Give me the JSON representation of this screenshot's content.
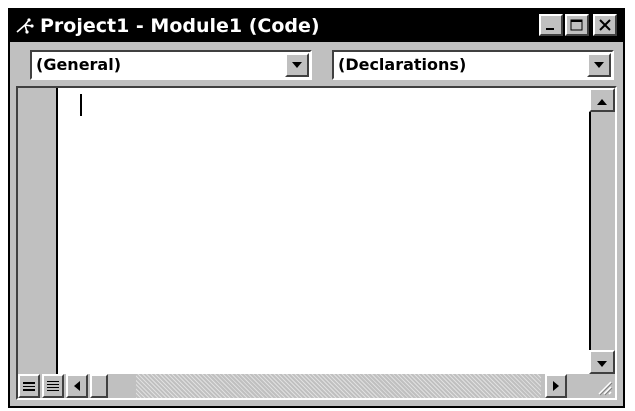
{
  "window": {
    "title": "Project1 - Module1 (Code)",
    "icons": {
      "app": "project-code-icon",
      "minimize": "minimize-icon",
      "maximize": "maximize-icon",
      "close": "close-icon"
    }
  },
  "object_combo": {
    "selected": "(General)",
    "icon": "chevron-down-icon"
  },
  "procedure_combo": {
    "selected": "(Declarations)",
    "icon": "chevron-down-icon"
  },
  "editor": {
    "code_text": ""
  },
  "scrollbars": {
    "vertical_icons": [
      "scroll-up-icon",
      "scroll-down-icon"
    ],
    "horizontal_icons": [
      "scroll-left-icon",
      "scroll-right-icon"
    ]
  },
  "view_buttons": {
    "procedure_view_icon": "procedure-view-icon",
    "full_module_view_icon": "full-module-view-icon"
  },
  "colors": {
    "titlebar": "#000000",
    "chrome": "#c0c0c0",
    "editor_bg": "#ffffff"
  }
}
